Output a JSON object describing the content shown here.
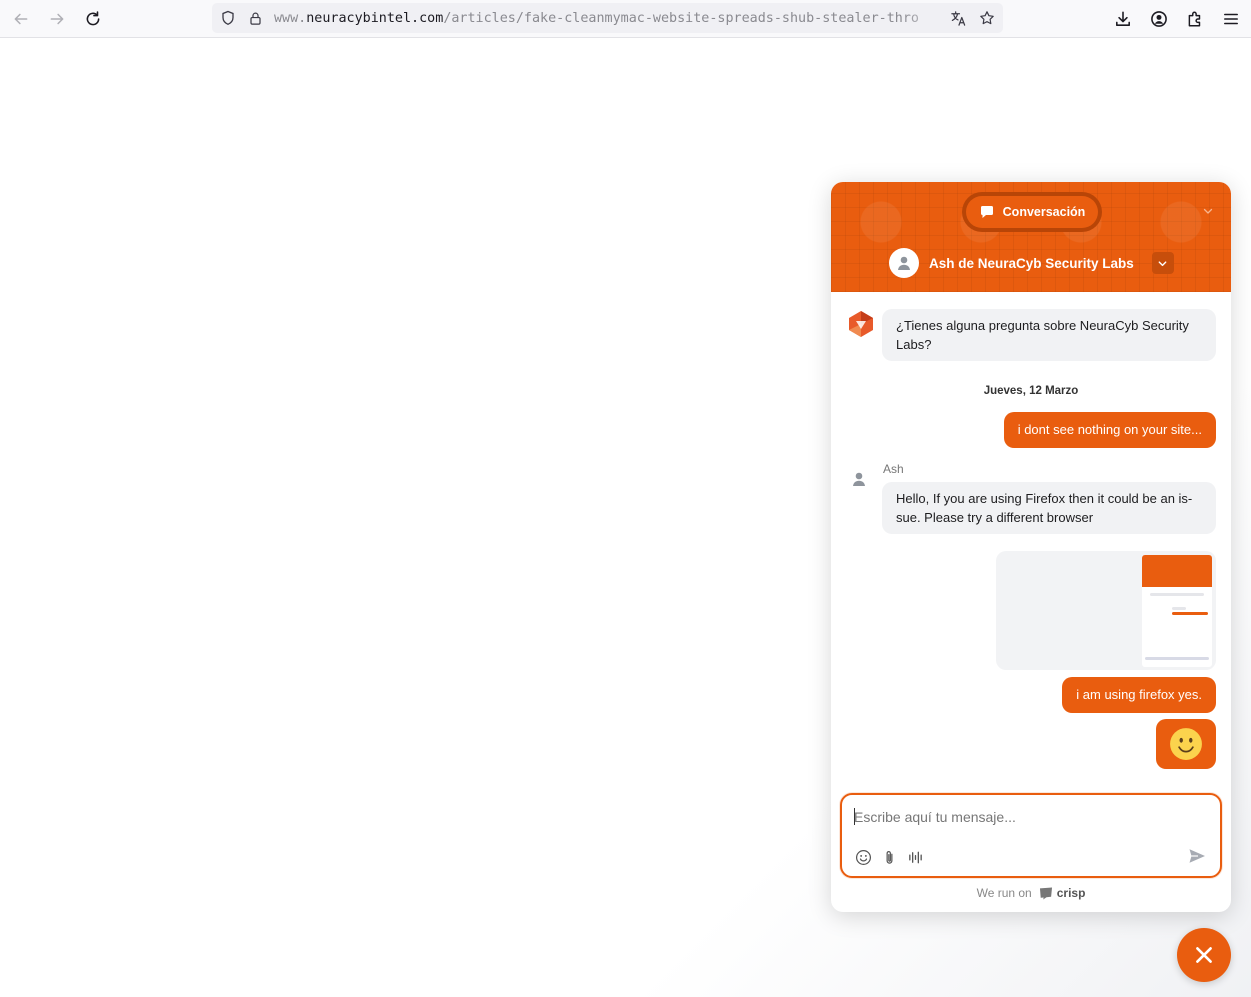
{
  "browser": {
    "url_prefix": "www.",
    "url_host": "neuracybintel.com",
    "url_path": "/articles/fake-cleanmymac-website-spreads-shub-stealer-thro"
  },
  "chat": {
    "tab_label": "Conversación",
    "agent_name": "Ash de NeuraCyb Security Labs",
    "messages": {
      "bot_greeting": "¿Tienes alguna pregunta sobre NeuraCyb Security Labs?",
      "date_separator": "Jueves, 12 Marzo",
      "user_1": "i dont see nothing on your site...",
      "operator_name": "Ash",
      "operator_reply": "Hello, If you are using Firefox then it could be an is-sue. Please try a different browser",
      "user_2": "i am using firefox yes.",
      "emoji": "🙂"
    },
    "composer_placeholder": "Escribe aquí tu mensaje...",
    "powered_prefix": "We run on",
    "powered_brand": "crisp"
  },
  "colors": {
    "accent": "#e95d0f",
    "bubble_in": "#f1f2f4"
  }
}
